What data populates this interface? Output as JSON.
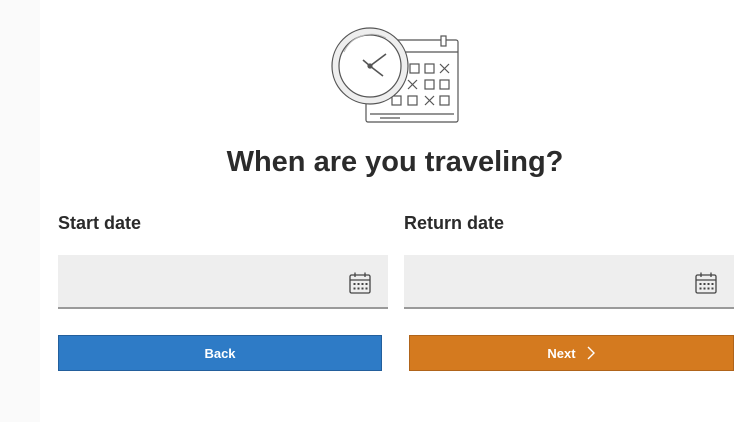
{
  "title": "When are you traveling?",
  "start": {
    "label": "Start date",
    "value": "",
    "icon": "calendar-icon"
  },
  "return": {
    "label": "Return date",
    "value": "",
    "icon": "calendar-icon"
  },
  "buttons": {
    "back_label": "Back",
    "next_label": "Next",
    "next_icon": "chevron-right-icon"
  },
  "colors": {
    "back": "#2e7bc6",
    "next": "#d47a1f",
    "field_bg": "#eeeeee",
    "text": "#2b2b2b"
  },
  "hero_icon": "clock-calendar-illustration"
}
